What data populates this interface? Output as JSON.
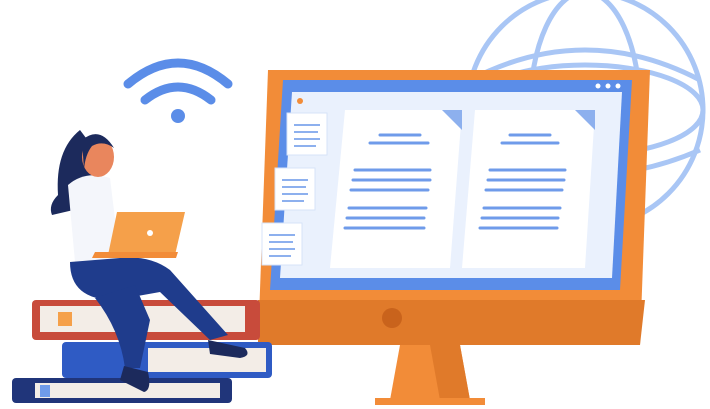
{
  "illustration": {
    "colors": {
      "monitor_frame": "#F28C38",
      "monitor_frame_shadow": "#E07A2A",
      "screen_border": "#5B8DE8",
      "screen_bg": "#EAF1FD",
      "document": "#FFFFFF",
      "text_line": "#6F9BEA",
      "globe": "#A9C6F5",
      "wifi": "#5B8DE8",
      "laptop": "#F5A04A",
      "book_red": "#C84B3B",
      "book_blue": "#2F5BC4",
      "book_navy": "#20357A",
      "pants": "#1F3C8C",
      "hair": "#1C2A5C",
      "shirt": "#F4F6FB",
      "skin": "#E9865D"
    },
    "icons": [
      "wifi-icon",
      "globe-icon",
      "laptop-icon",
      "book-icon",
      "document-icon"
    ]
  }
}
